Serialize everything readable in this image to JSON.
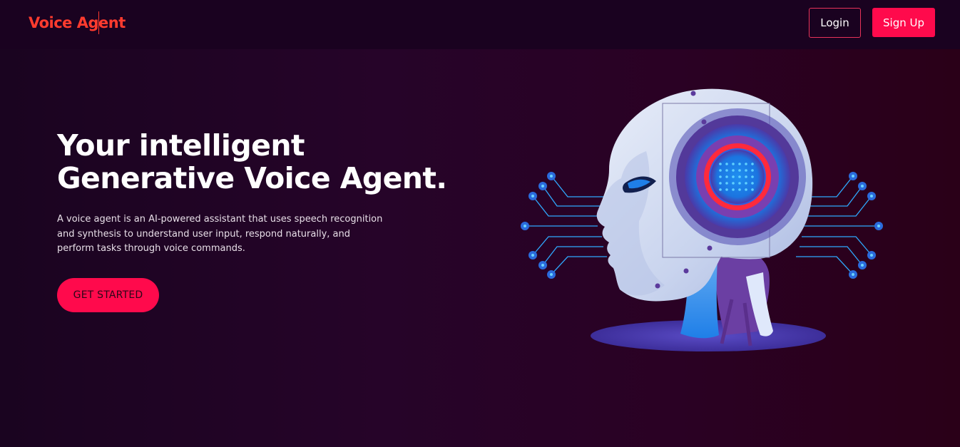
{
  "nav": {
    "logo_text": "Voice Agent",
    "login_label": "Login",
    "signup_label": "Sign Up"
  },
  "hero": {
    "title_line1": "Your intelligent",
    "title_line2": "Generative Voice Agent.",
    "description": "A voice agent is an AI-powered assistant that uses speech recognition and synthesis to understand user input, respond naturally, and perform tasks through voice commands.",
    "cta_label": "GET STARTED"
  },
  "colors": {
    "brand": "#ff3b2e",
    "accent": "#ff0a4c",
    "background": "#260429"
  },
  "illustration": {
    "icon": "robot-head-illustration-icon"
  }
}
